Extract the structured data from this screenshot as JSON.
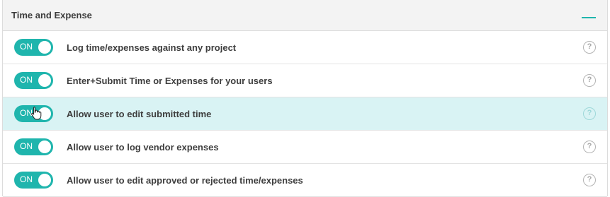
{
  "section": {
    "title": "Time and Expense",
    "collapse_icon": "minus-icon",
    "accent_color": "#1fb5ad"
  },
  "settings": [
    {
      "toggle": "ON",
      "label": "Log time/expenses against any project",
      "help": "?"
    },
    {
      "toggle": "ON",
      "label": "Enter+Submit Time or Expenses for your users",
      "help": "?"
    },
    {
      "toggle": "ON",
      "label": "Allow user to edit submitted time",
      "help": "?"
    },
    {
      "toggle": "ON",
      "label": "Allow user to log vendor expenses",
      "help": "?"
    },
    {
      "toggle": "ON",
      "label": "Allow user to edit approved or rejected time/expenses",
      "help": "?"
    }
  ]
}
